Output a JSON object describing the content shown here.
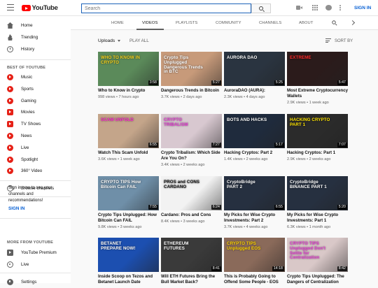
{
  "header": {
    "logo_text": "YouTube",
    "search_placeholder": "Search",
    "signin_label": "SIGN IN"
  },
  "sidebar": {
    "main": [
      {
        "label": "Home",
        "icon": "home-icon"
      },
      {
        "label": "Trending",
        "icon": "trending-icon"
      },
      {
        "label": "History",
        "icon": "history-icon"
      }
    ],
    "best_heading": "BEST OF YOUTUBE",
    "best": [
      {
        "label": "Music",
        "icon": "music-icon"
      },
      {
        "label": "Sports",
        "icon": "sports-icon"
      },
      {
        "label": "Gaming",
        "icon": "gaming-icon"
      },
      {
        "label": "Movies",
        "icon": "movies-icon"
      },
      {
        "label": "TV Shows",
        "icon": "tv-shows-icon"
      },
      {
        "label": "News",
        "icon": "news-icon"
      },
      {
        "label": "Live",
        "icon": "live-icon"
      },
      {
        "label": "Spotlight",
        "icon": "spotlight-icon"
      },
      {
        "label": "360° Video",
        "icon": "360-video-icon"
      }
    ],
    "browse_channels": "Browse channels",
    "signin_prompt": "Sign in now to see your channels and recommendations!",
    "signin_link": "SIGN IN",
    "more_heading": "MORE FROM YOUTUBE",
    "more": [
      {
        "label": "YouTube Premium",
        "icon": "youtube-premium-icon"
      },
      {
        "label": "Live",
        "icon": "live-broadcast-icon"
      },
      {
        "label": "Settings",
        "icon": "settings-icon"
      }
    ]
  },
  "channel_tabs": [
    "HOME",
    "VIDEOS",
    "PLAYLISTS",
    "COMMUNITY",
    "CHANNELS",
    "ABOUT"
  ],
  "active_tab": "VIDEOS",
  "uploads_label": "Uploads",
  "play_all_label": "PLAY ALL",
  "sort_by_label": "SORT BY",
  "videos": [
    {
      "title": "Who to Know in Crypto",
      "meta": "998 views • 7 hours ago",
      "duration": "3:58",
      "overlay": "WHO TO KNOW IN CRYPTO",
      "overlay_color": "#f7d11b",
      "bg": "#5b8a5a"
    },
    {
      "title": "Dangerous Trends in Bitcoin",
      "meta": "3.7K views • 2 days ago",
      "duration": "5:27",
      "overlay": "Crypto Tips Unplugged Dangerous Trends in BTC",
      "overlay_color": "#ffffff",
      "bg": "#c79a7a"
    },
    {
      "title": "AuroraDAO (AURA): Undervalued?",
      "meta": "2.3K views • 4 days ago",
      "duration": "5:25",
      "overlay": "AURORA DAO",
      "overlay_color": "#ffffff",
      "bg": "#2a3440"
    },
    {
      "title": "Most Extreme Cryptocurrency Wallets",
      "meta": "2.9K views • 1 week ago",
      "duration": "5:47",
      "overlay": "EXTREME",
      "overlay_color": "#ff2a2a",
      "bg": "#2b1b1b"
    },
    {
      "title": "Watch This Scam Unfold",
      "meta": "3.6K views • 1 week ago",
      "duration": "6:55",
      "overlay": "SCAM UNFOLD",
      "overlay_color": "#ff2ad0",
      "bg": "#c4a58a"
    },
    {
      "title": "Crypto Tribalism: Which Side Are You On?",
      "meta": "3.4K views • 2 weeks ago",
      "duration": "7:27",
      "overlay": "CRYPTO TRIBALISM",
      "overlay_color": "#e83bd6",
      "bg": "#d8c8d0"
    },
    {
      "title": "Hacking Cryptos: Part 2",
      "meta": "1.4K views • 2 weeks ago",
      "duration": "5:17",
      "overlay": "BOTS AND HACKS",
      "overlay_color": "#ffffff",
      "bg": "#1f2b3d"
    },
    {
      "title": "Hacking Cryptos: Part 1",
      "meta": "2.9K views • 2 weeks ago",
      "duration": "7:07",
      "overlay": "HACKING CRYPTO PART 1",
      "overlay_color": "#ffe400",
      "bg": "#2b2b2b"
    },
    {
      "title": "Crypto Tips Unplugged: How Bitcoin Can FAIL",
      "meta": "9.8K views • 3 weeks ago",
      "duration": "7:55",
      "overlay": "CRYPTO TIPS How Bitcoin Can FAIL",
      "overlay_color": "#ffffff",
      "bg": "#6f8fa8"
    },
    {
      "title": "Cardano: Pros and Cons",
      "meta": "8.4K views • 3 weeks ago",
      "duration": "6:24",
      "overlay": "PROS and CONS CARDANO",
      "overlay_color": "#111111",
      "bg": "#f2f2f2"
    },
    {
      "title": "My Picks for Wise Crypto Investments: Part 2",
      "meta": "3.7K views • 4 weeks ago",
      "duration": "6:55",
      "overlay": "CryptoBridge PART 2",
      "overlay_color": "#ffffff",
      "bg": "#263040"
    },
    {
      "title": "My Picks for Wise Crypto Investments: Part 1",
      "meta": "6.3K views • 1 month ago",
      "duration": "5:20",
      "overlay": "CryptoBridge BINANCE PART 1",
      "overlay_color": "#ffffff",
      "bg": "#263040"
    },
    {
      "title": "Inside Scoop on Tezos and Betanet Launch Date",
      "meta": "",
      "duration": "",
      "overlay": "BETANET PREPARE NOW!",
      "overlay_color": "#ffffff",
      "bg": "#1c4fb0"
    },
    {
      "title": "Will ETH Futures Bring the Bull Market Back?",
      "meta": "",
      "duration": "8:41",
      "overlay": "ETHEREUM FUTURES",
      "overlay_color": "#ffffff",
      "bg": "#3a3a3a"
    },
    {
      "title": "This is Probably Going to Offend Some People - EOS",
      "meta": "",
      "duration": "14:18",
      "overlay": "CRYPTO TIPS Unplugged EOS",
      "overlay_color": "#ffd400",
      "bg": "#8a6a5a"
    },
    {
      "title": "Crypto Tips Unplugged: The Dangers of Centralization",
      "meta": "",
      "duration": "8:42",
      "overlay": "CRYPTO TIPS Unplugged Don't Settle for Centralization",
      "overlay_color": "#e83bd6",
      "bg": "#d9c8c8"
    }
  ]
}
